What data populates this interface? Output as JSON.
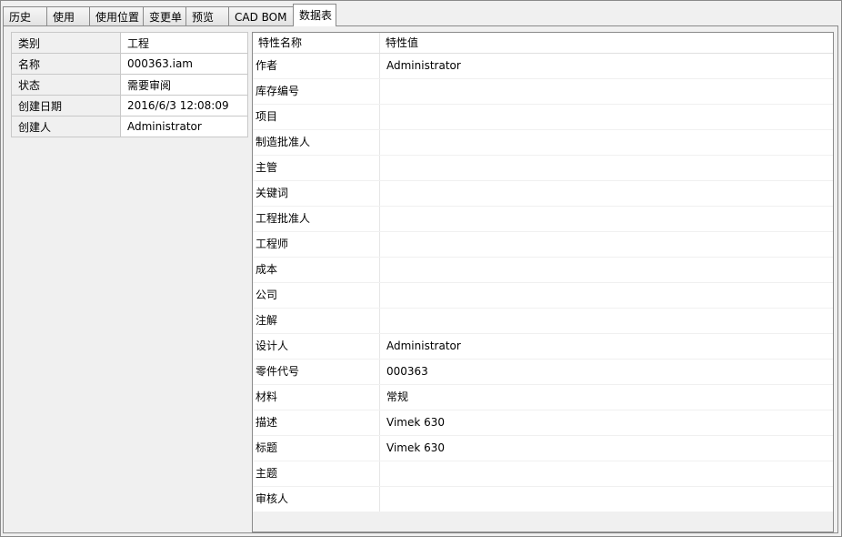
{
  "tabs": [
    {
      "label": "历史"
    },
    {
      "label": "使用"
    },
    {
      "label": "使用位置"
    },
    {
      "label": "变更单"
    },
    {
      "label": "预览"
    },
    {
      "label": "CAD BOM"
    },
    {
      "label": "数据表"
    }
  ],
  "active_tab": "数据表",
  "summary": {
    "rows": [
      {
        "key": "类别",
        "value": "工程"
      },
      {
        "key": "名称",
        "value": "000363.iam"
      },
      {
        "key": "状态",
        "value": "需要审阅"
      },
      {
        "key": "创建日期",
        "value": "2016/6/3 12:08:09"
      },
      {
        "key": "创建人",
        "value": "Administrator"
      }
    ]
  },
  "properties": {
    "header": {
      "name": "特性名称",
      "value": "特性值"
    },
    "rows": [
      {
        "name": "作者",
        "value": "Administrator"
      },
      {
        "name": "库存编号",
        "value": ""
      },
      {
        "name": "项目",
        "value": ""
      },
      {
        "name": "制造批准人",
        "value": ""
      },
      {
        "name": "主管",
        "value": ""
      },
      {
        "name": "关键词",
        "value": ""
      },
      {
        "name": "工程批准人",
        "value": ""
      },
      {
        "name": "工程师",
        "value": ""
      },
      {
        "name": "成本",
        "value": ""
      },
      {
        "name": "公司",
        "value": ""
      },
      {
        "name": "注解",
        "value": ""
      },
      {
        "name": "设计人",
        "value": "Administrator"
      },
      {
        "name": "零件代号",
        "value": "000363"
      },
      {
        "name": "材料",
        "value": "常规"
      },
      {
        "name": "描述",
        "value": "Vimek 630"
      },
      {
        "name": "标题",
        "value": "Vimek 630"
      },
      {
        "name": "主题",
        "value": ""
      },
      {
        "name": "审核人",
        "value": ""
      }
    ]
  }
}
